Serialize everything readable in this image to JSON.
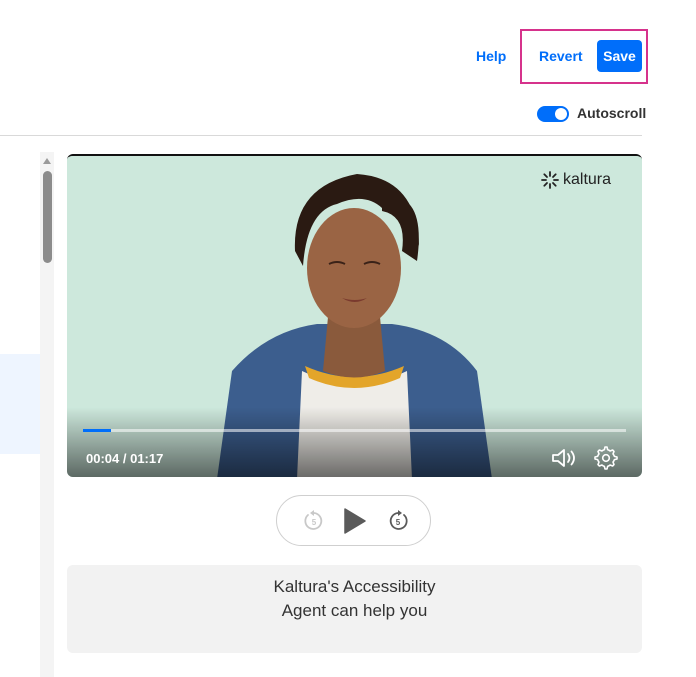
{
  "toolbar": {
    "help_label": "Help",
    "revert_label": "Revert",
    "save_label": "Save",
    "accent_color": "#006EFA",
    "highlight_color": "#D6328C"
  },
  "autoscroll": {
    "label": "Autoscroll",
    "enabled": true
  },
  "player": {
    "brand": "kaltura",
    "time_display": "00:04 / 01:17",
    "progress_fraction": 0.052,
    "icons": [
      "volume-icon",
      "settings-gear-icon"
    ]
  },
  "playback_controls": {
    "rewind_seconds": "5",
    "forward_seconds": "5",
    "icons": [
      "rewind-5-icon",
      "play-icon",
      "forward-5-icon"
    ]
  },
  "agent": {
    "line1": "Kaltura's Accessibility",
    "line2": "Agent can help you"
  }
}
